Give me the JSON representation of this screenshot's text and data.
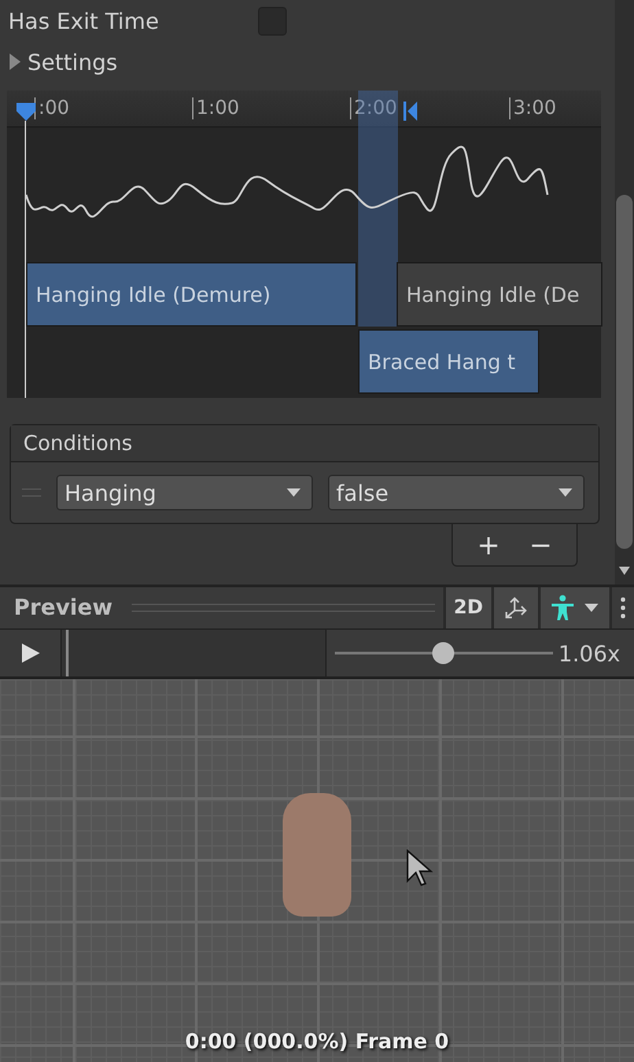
{
  "has_exit_time": {
    "label": "Has Exit Time",
    "checked": false
  },
  "settings": {
    "label": "Settings",
    "expanded": false
  },
  "timeline": {
    "ticks": [
      ":00",
      "1:00",
      "2:00",
      "3:00"
    ],
    "clips": [
      {
        "label": "Hanging Idle (Demure)",
        "selected": true
      },
      {
        "label": "Hanging Idle (De",
        "selected": false
      },
      {
        "label": "Braced Hang t",
        "selected": true
      }
    ]
  },
  "conditions": {
    "title": "Conditions",
    "rows": [
      {
        "parameter": "Hanging",
        "value": "false"
      }
    ],
    "add": "+",
    "remove": "−"
  },
  "preview": {
    "title": "Preview",
    "mode": "2D",
    "speed": {
      "level": 0.5,
      "reading": "1.06x"
    },
    "status": "0:00 (000.0%) Frame 0"
  }
}
